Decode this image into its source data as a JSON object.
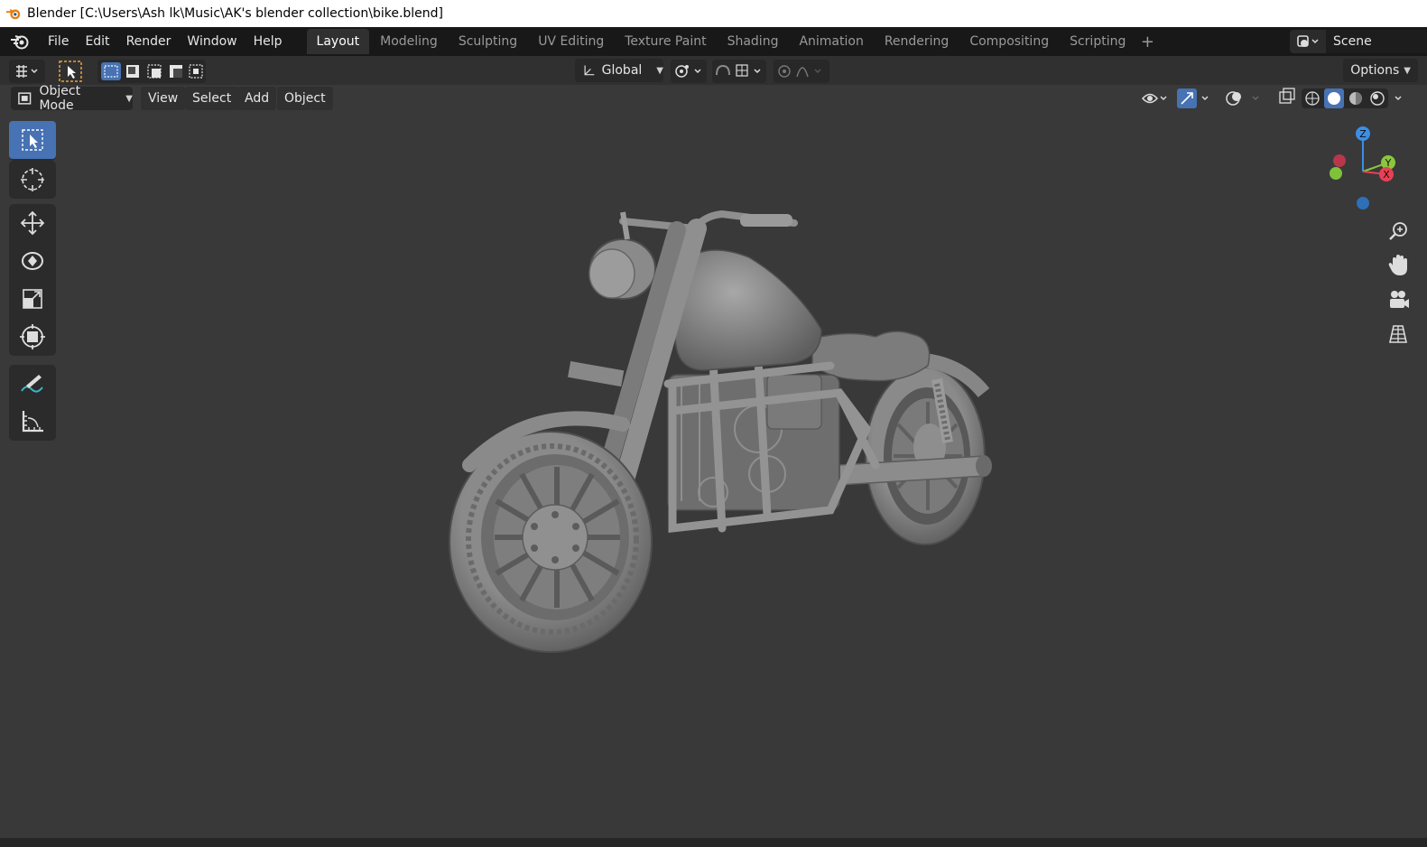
{
  "window": {
    "title": "Blender [C:\\Users\\Ash lk\\Music\\AK's blender collection\\bike.blend]"
  },
  "menu": {
    "items": [
      "File",
      "Edit",
      "Render",
      "Window",
      "Help"
    ]
  },
  "workspaces": {
    "tabs": [
      "Layout",
      "Modeling",
      "Sculpting",
      "UV Editing",
      "Texture Paint",
      "Shading",
      "Animation",
      "Rendering",
      "Compositing",
      "Scripting"
    ],
    "active": "Layout",
    "add_label": "+"
  },
  "scene": {
    "name": "Scene"
  },
  "tool_header": {
    "orientation": "Global",
    "options_label": "Options"
  },
  "viewport_header": {
    "mode": "Object Mode",
    "menus": [
      "View",
      "Select",
      "Add",
      "Object"
    ]
  },
  "gizmo": {
    "z_label": "Z",
    "y_label": "Y",
    "x_label": "X"
  },
  "colors": {
    "accent": "#4772b3",
    "axis_x": "#e94055",
    "axis_y": "#8cc63f",
    "axis_z": "#3b8fe6",
    "blender_orange": "#e87d0d"
  },
  "icons": {
    "tools": [
      "select-box-icon",
      "cursor-icon",
      "move-icon",
      "rotate-icon",
      "scale-icon",
      "transform-icon",
      "annotate-icon",
      "measure-icon"
    ],
    "navigation": [
      "zoom-icon",
      "pan-hand-icon",
      "camera-view-icon",
      "ortho-grid-icon"
    ]
  }
}
